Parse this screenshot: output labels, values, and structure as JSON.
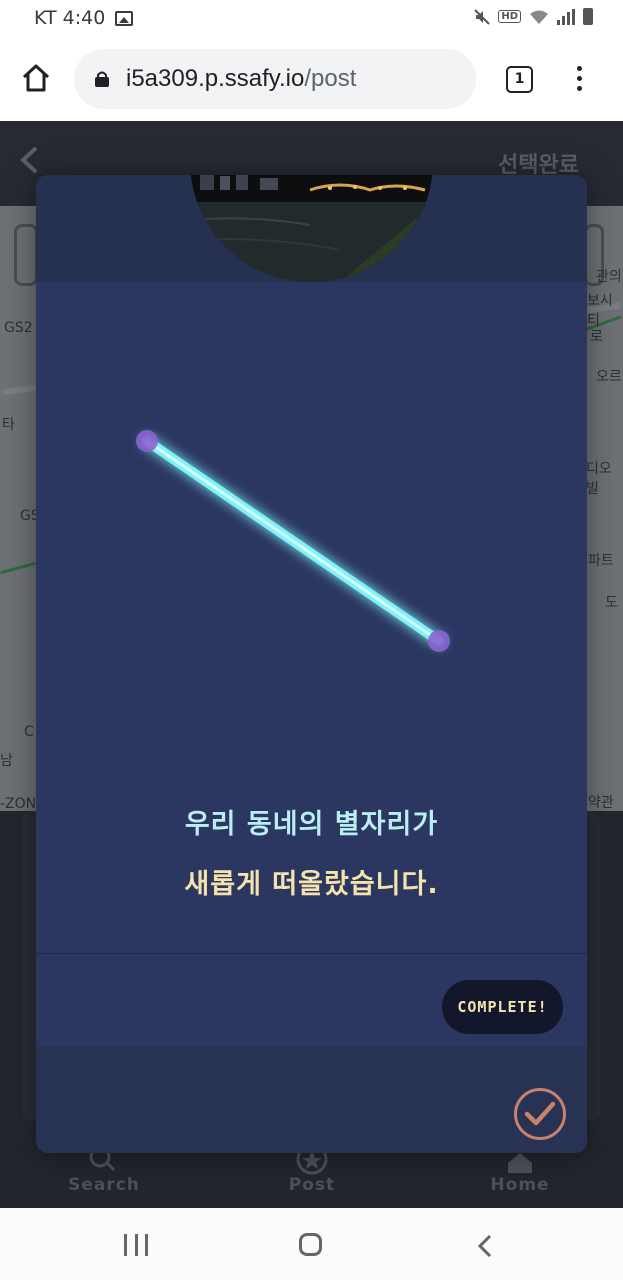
{
  "status_bar": {
    "carrier_time": "KT 4:40",
    "icons": [
      "image-icon",
      "mute-icon",
      "hd-icon",
      "wifi-icon",
      "signal-icon",
      "battery-icon"
    ],
    "hd_label": "HD"
  },
  "browser": {
    "url_host": "i5a309.p.ssafy.io",
    "url_path": "/post",
    "tab_count": "1",
    "icons": [
      "home-icon",
      "lock-icon",
      "menu-dots-icon"
    ]
  },
  "app": {
    "header": {
      "back_icon": "chevron-left-icon",
      "action_label": "선택완료"
    },
    "map_labels": [
      "GS2",
      "GS",
      "타",
      "C",
      "남",
      "-ZON",
      "관의",
      "보시티",
      "오르",
      "디오빌",
      "파트",
      "도",
      "약관",
      "로"
    ],
    "bottom_nav": [
      {
        "label": "Search",
        "icon": "search-icon"
      },
      {
        "label": "Post",
        "icon": "star-icon"
      },
      {
        "label": "Home",
        "icon": "home-icon"
      }
    ]
  },
  "modal": {
    "photo_icon": "night-river-photo",
    "message_line1": "우리 동네의 별자리가",
    "message_line2": "새롭게 떠올랐습니다.",
    "complete_label": "COMPLETE!",
    "check_icon": "check-icon",
    "colors": {
      "background": "#2b3661",
      "line_glow": "#7df3f7",
      "star_point": "#8a63d2",
      "text_primary": "#b9eef3",
      "text_secondary": "#f4e3ad",
      "check_ring": "#c9826a"
    }
  },
  "android_nav": {
    "icons": [
      "recent-apps-icon",
      "home-button-icon",
      "back-icon"
    ]
  }
}
